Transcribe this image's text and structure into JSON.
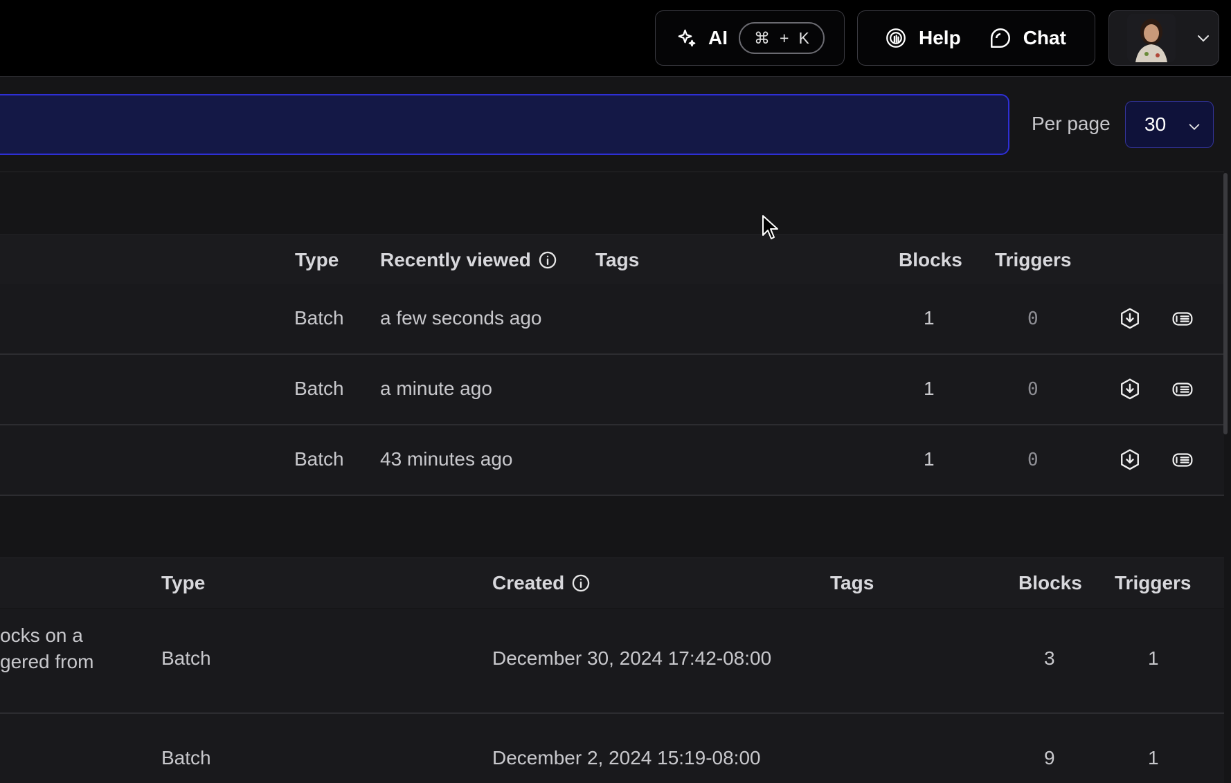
{
  "header": {
    "ai_label": "AI",
    "shortcut": {
      "cmd": "⌘",
      "plus": "+",
      "key": "K"
    },
    "help_label": "Help",
    "chat_label": "Chat"
  },
  "search": {
    "placeholder": ""
  },
  "pagination": {
    "per_page_label": "Per page",
    "per_page_value": "30"
  },
  "recent_table": {
    "columns": {
      "type": "Type",
      "recently_viewed": "Recently viewed",
      "tags": "Tags",
      "blocks": "Blocks",
      "triggers": "Triggers"
    },
    "rows": [
      {
        "type": "Batch",
        "recently_viewed": "a few seconds ago",
        "blocks": "1",
        "triggers": "0"
      },
      {
        "type": "Batch",
        "recently_viewed": "a minute ago",
        "blocks": "1",
        "triggers": "0"
      },
      {
        "type": "Batch",
        "recently_viewed": "43 minutes ago",
        "blocks": "1",
        "triggers": "0"
      }
    ]
  },
  "all_table": {
    "columns": {
      "type": "Type",
      "created": "Created",
      "tags": "Tags",
      "blocks": "Blocks",
      "triggers": "Triggers"
    },
    "rows": [
      {
        "description_line1": "ocks on a",
        "description_line2": "gered from",
        "type": "Batch",
        "created": "December 30, 2024 17:42-08:00",
        "blocks": "3",
        "triggers": "1"
      },
      {
        "type": "Batch",
        "created": "December 2, 2024 15:19-08:00",
        "blocks": "9",
        "triggers": "1"
      }
    ]
  },
  "icons": [
    "sparkle-icon",
    "help-icon",
    "chat-icon",
    "chevron-down-icon",
    "info-icon",
    "download-icon",
    "logs-icon",
    "cursor-icon"
  ]
}
